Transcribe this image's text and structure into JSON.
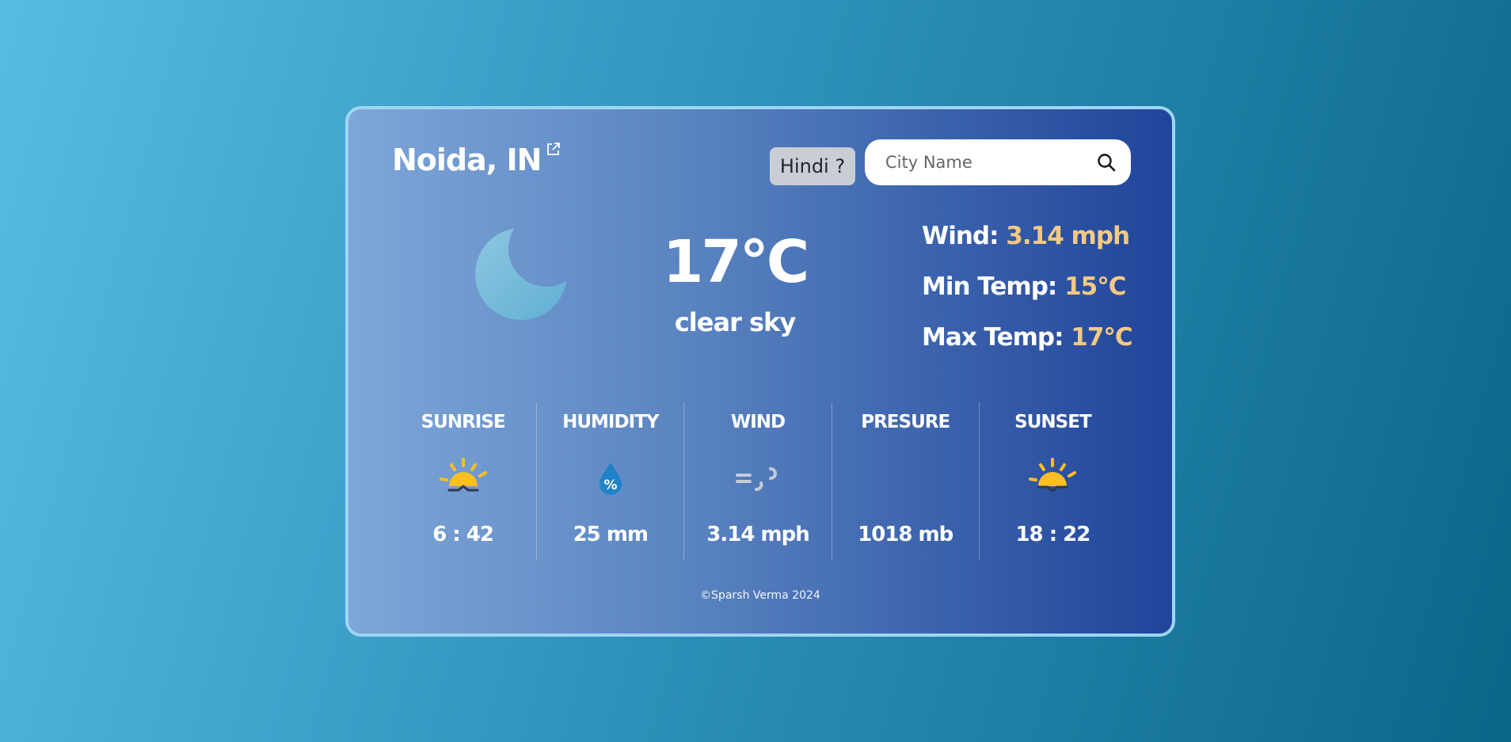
{
  "location": {
    "city": "Noida, IN",
    "link_icon": "external-link-icon"
  },
  "header": {
    "language_button": "Hindi ?",
    "search": {
      "placeholder": "City Name",
      "value": "",
      "icon": "search-icon"
    }
  },
  "current": {
    "icon": "moon-icon",
    "temperature": "17°C",
    "description": "clear sky"
  },
  "stats": {
    "wind": {
      "label": "Wind: ",
      "value": "3.14 mph"
    },
    "min_temp": {
      "label": "Min Temp: ",
      "value": "15°C"
    },
    "max_temp": {
      "label": "Max Temp: ",
      "value": "17°C"
    }
  },
  "details": [
    {
      "title": "SUNRISE",
      "icon": "sunrise-icon",
      "value": "6 : 42"
    },
    {
      "title": "HUMIDITY",
      "icon": "humidity-drop-icon",
      "value": "25 mm"
    },
    {
      "title": "WIND",
      "icon": "wind-icon",
      "value": "3.14 mph"
    },
    {
      "title": "PRESURE",
      "icon": "",
      "value": "1018 mb"
    },
    {
      "title": "SUNSET",
      "icon": "sunset-icon",
      "value": "18 : 22"
    }
  ],
  "footer": "©Sparsh Verma 2024",
  "colors": {
    "accent_value": "#f5c983",
    "card_start": "#7ea6d8",
    "card_end": "#20449a",
    "sun": "#fbbf24"
  }
}
